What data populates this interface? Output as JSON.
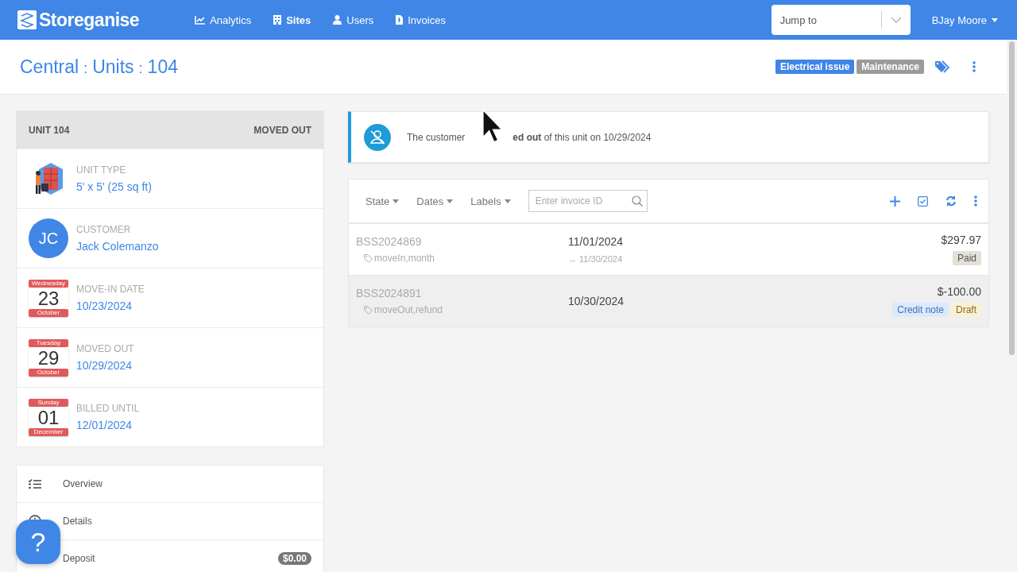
{
  "nav": {
    "logo": "Storeganise",
    "items": [
      {
        "label": "Analytics",
        "selected": false
      },
      {
        "label": "Sites",
        "selected": true
      },
      {
        "label": "Users",
        "selected": false
      },
      {
        "label": "Invoices",
        "selected": false
      }
    ],
    "jump_to": {
      "placeholder": "Jump to"
    },
    "user": "BJay Moore"
  },
  "header": {
    "breadcrumb": [
      "Central",
      "Units",
      "104"
    ],
    "separator": ":",
    "labels": [
      {
        "text": "Electrical issue",
        "color": "#3f86e6"
      },
      {
        "text": "Maintenance",
        "color": "#9b9b9b"
      }
    ]
  },
  "unit": {
    "title": "UNIT 104",
    "status": "MOVED OUT",
    "rows": [
      {
        "kind": "image",
        "label": "UNIT TYPE",
        "value": "5' x 5' (25 sq ft)"
      },
      {
        "kind": "avatar",
        "initials": "JC",
        "label": "CUSTOMER",
        "value": "Jack Colemanzo"
      },
      {
        "kind": "date",
        "weekday": "Wednesday",
        "day": "23",
        "month": "October",
        "label": "MOVE-IN DATE",
        "value": "10/23/2024"
      },
      {
        "kind": "date",
        "weekday": "Tuesday",
        "day": "29",
        "month": "October",
        "label": "MOVED OUT",
        "value": "10/29/2024"
      },
      {
        "kind": "date",
        "weekday": "Sunday",
        "day": "01",
        "month": "December",
        "label": "BILLED UNTIL",
        "value": "12/01/2024"
      }
    ]
  },
  "menu": [
    {
      "label": "Overview"
    },
    {
      "label": "Details"
    },
    {
      "label": "Deposit",
      "badge": "$0.00"
    }
  ],
  "alert": {
    "text_before": "The customer",
    "text_after": "**ed out** of this unit on 10/29/2024"
  },
  "invoices": {
    "filters": [
      "State",
      "Dates",
      "Labels"
    ],
    "search": {
      "placeholder": "Enter invoice ID"
    },
    "rows": [
      {
        "id": "BSS2024869",
        "tags": "moveIn,month",
        "date": "11/01/2024",
        "end": "→ 11/30/2024",
        "amount": "$297.97",
        "highlighted": false,
        "badges": [
          {
            "text": "Paid",
            "kind": "paid"
          }
        ]
      },
      {
        "id": "BSS2024891",
        "tags": "moveOut,refund",
        "date": "10/30/2024",
        "amount": "$-100.00",
        "highlighted": true,
        "badges": [
          {
            "text": "Credit note",
            "kind": "credit"
          },
          {
            "text": "Draft",
            "kind": "draft"
          }
        ]
      }
    ]
  },
  "help": {
    "label": "?"
  }
}
